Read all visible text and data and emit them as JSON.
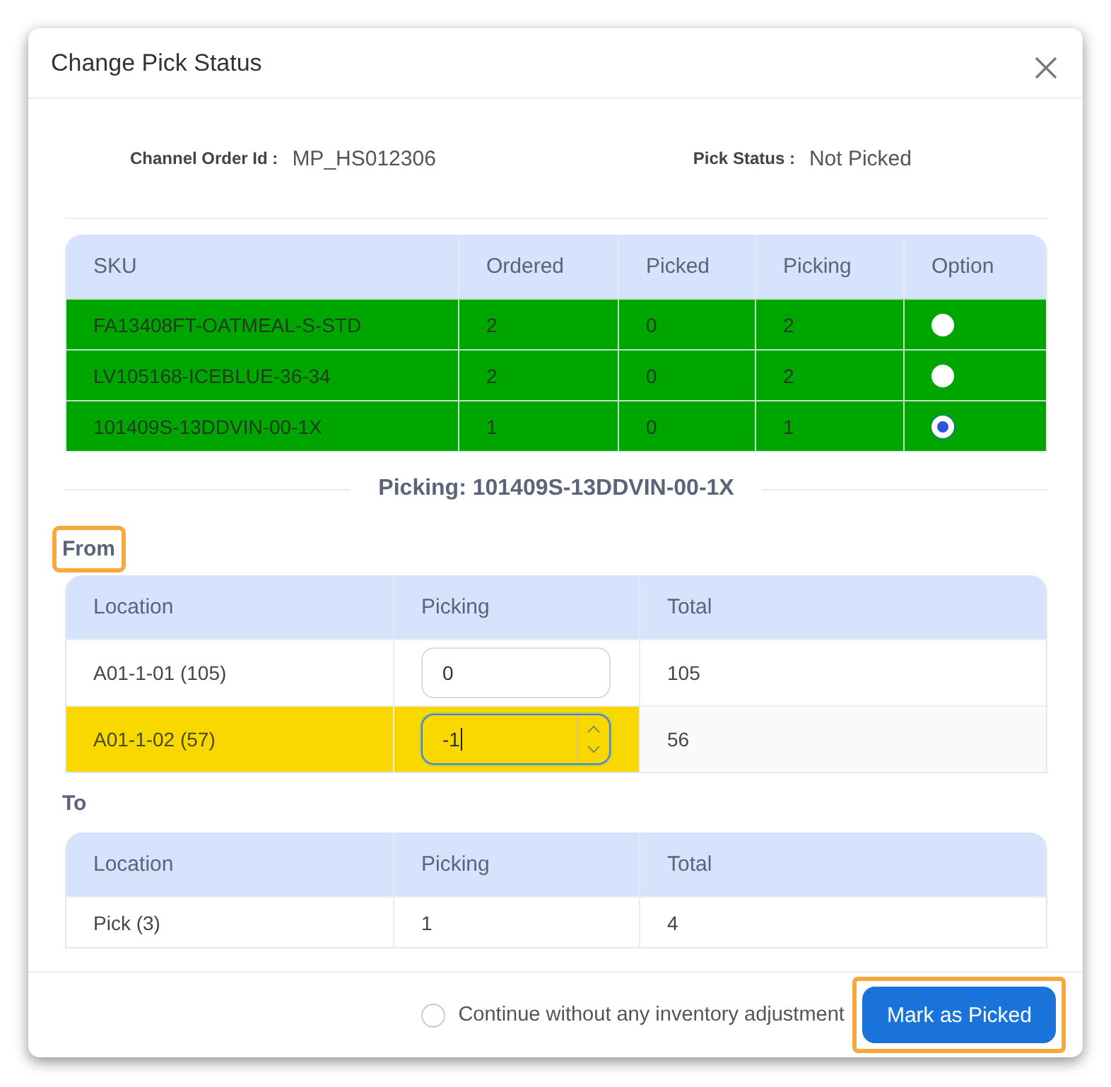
{
  "dialog": {
    "title": "Change Pick Status"
  },
  "info": [
    {
      "label": "Channel Order Id :",
      "value": "MP_HS012306"
    },
    {
      "label": "Pick Status :",
      "value": "Not Picked"
    }
  ],
  "sku_table": {
    "columns": [
      "SKU",
      "Ordered",
      "Picked",
      "Picking",
      "Option"
    ],
    "rows": [
      {
        "sku": "FA13408FT-OATMEAL-S-STD",
        "ordered": "2",
        "picked": "0",
        "picking": "2",
        "selected": false
      },
      {
        "sku": "LV105168-ICEBLUE-36-34",
        "ordered": "2",
        "picked": "0",
        "picking": "2",
        "selected": false
      },
      {
        "sku": "101409S-13DDVIN-00-1X",
        "ordered": "1",
        "picked": "0",
        "picking": "1",
        "selected": true
      }
    ]
  },
  "picking_title": "Picking: 101409S-13DDVIN-00-1X",
  "from": {
    "label": "From",
    "highlighted": true,
    "columns": [
      "Location",
      "Picking",
      "Total"
    ],
    "rows": [
      {
        "location": "A01-1-01 (105)",
        "picking": "0",
        "total": "105",
        "highlighted": false,
        "focused": false
      },
      {
        "location": "A01-1-02 (57)",
        "picking": "-1",
        "total": "56",
        "highlighted": true,
        "focused": true
      }
    ]
  },
  "to": {
    "label": "To",
    "highlighted": false,
    "columns": [
      "Location",
      "Picking",
      "Total"
    ],
    "rows": [
      {
        "location": "Pick (3)",
        "picking": "1",
        "total": "4"
      }
    ]
  },
  "footer": {
    "option": {
      "label": "Continue without any inventory adjustment",
      "checked": false
    },
    "button": {
      "label": "Mark as Picked",
      "highlighted": true
    }
  }
}
